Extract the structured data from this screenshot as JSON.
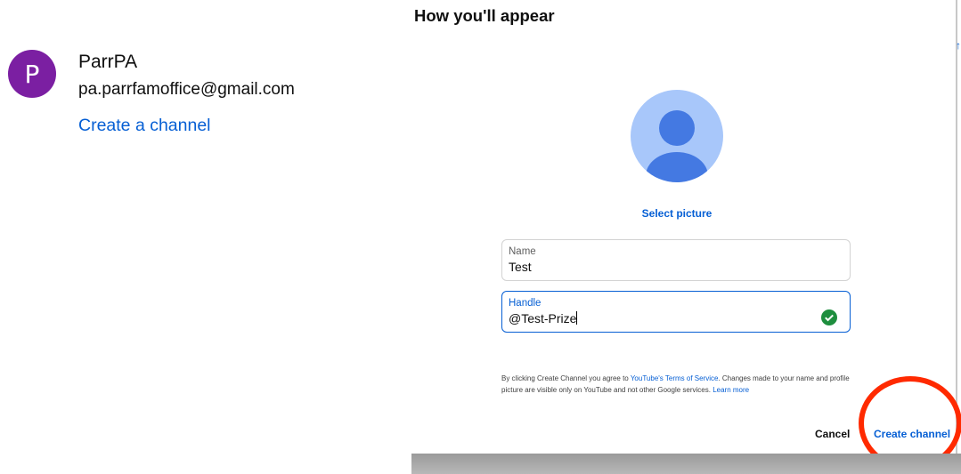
{
  "account": {
    "avatar_letter": "P",
    "avatar_color": "#7b1fa2",
    "name": "ParrPA",
    "email": "pa.parrfamoffice@gmail.com",
    "create_channel_link": "Create a channel"
  },
  "dialog": {
    "title": "How you'll appear",
    "select_picture": "Select picture",
    "name_field": {
      "label": "Name",
      "value": "Test"
    },
    "handle_field": {
      "label": "Handle",
      "value": "@Test-Prize"
    },
    "terms": {
      "part1": "By clicking Create Channel you agree to ",
      "tos_link": "YouTube's Terms of Service",
      "part2": ". Changes made to your name and profile picture are visible only on YouTube and not other Google services. ",
      "learn_more": "Learn more"
    },
    "cancel_label": "Cancel",
    "create_label": "Create channel"
  },
  "colors": {
    "accent": "#065fd4",
    "success": "#1e8e3e",
    "highlight": "#ff2a00",
    "avatar_bg": "#a8c7fa",
    "avatar_fg": "#4479e2"
  },
  "icons": [
    "default-profile-icon",
    "check-circle-icon"
  ]
}
